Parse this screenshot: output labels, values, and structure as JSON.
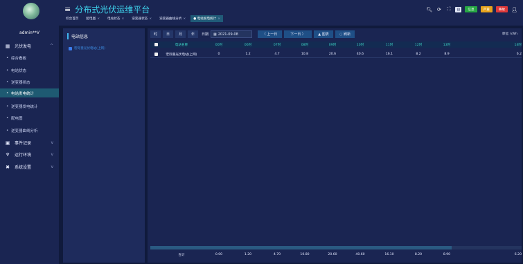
{
  "user": {
    "name": "admin**V"
  },
  "header": {
    "title": "分布式光伏运维平台",
    "tabs": [
      {
        "label": "综合首页",
        "closable": false
      },
      {
        "label": "配电图",
        "closable": true
      },
      {
        "label": "电站状态",
        "closable": true
      },
      {
        "label": "逆变器状态",
        "closable": true
      },
      {
        "label": "逆变器曲线分析",
        "closable": true
      },
      {
        "label": "● 电站发电统计",
        "closable": true,
        "selected": true
      }
    ],
    "close_glyph": "×",
    "badges": [
      {
        "label": "信息",
        "color": "#27a844"
      },
      {
        "label": "严重",
        "color": "#e8a41c"
      },
      {
        "label": "事故",
        "color": "#e03a3a"
      }
    ]
  },
  "sidebar": {
    "groups": [
      {
        "label": "光伏发电",
        "icon": "grid-icon",
        "glyph": "▦",
        "chevron": "^"
      },
      {
        "label": "事件记录",
        "icon": "record-icon",
        "glyph": "▣",
        "chevron": "v"
      },
      {
        "label": "运行环境",
        "icon": "tree-icon",
        "glyph": "♆",
        "chevron": "v"
      },
      {
        "label": "系统设置",
        "icon": "tools-icon",
        "glyph": "✖",
        "chevron": "v"
      }
    ],
    "items": [
      {
        "label": "综合看板"
      },
      {
        "label": "电站状态"
      },
      {
        "label": "逆变器状态"
      },
      {
        "label": "电站发电统计",
        "active": true
      },
      {
        "label": "逆变器发电统计"
      },
      {
        "label": "配电图"
      },
      {
        "label": "逆变器曲线分析"
      }
    ]
  },
  "station_panel": {
    "title": "电站信息",
    "tree_item": "宏际重光伏电站(上网)"
  },
  "toolbar": {
    "buttons": [
      "时",
      "日",
      "月",
      "年"
    ],
    "date_label": "日期",
    "date_value": "2021-09-08",
    "prev_label": "〈 上一日",
    "next_label": "下一日 〉",
    "chart_label": "▲ 图表",
    "refresh_label": "◌ 刷新",
    "unit_label": "单位: kWh"
  },
  "table": {
    "columns": [
      "电站名称",
      "00时",
      "06时",
      "07时",
      "08时",
      "09时",
      "10时",
      "11时",
      "12时",
      "13时",
      "14时"
    ],
    "rows": [
      {
        "name": "宏际重光伏电站(上网)",
        "values": [
          "0",
          "1.2",
          "4.7",
          "10.8",
          "20.6",
          "40.6",
          "16.1",
          "8.2",
          "8.9",
          "6.2"
        ]
      }
    ],
    "totals_label": "合计",
    "totals": [
      "0.00",
      "1.20",
      "4.70",
      "10.80",
      "20.60",
      "40.60",
      "16.10",
      "8.20",
      "8.90",
      "6.20"
    ]
  }
}
